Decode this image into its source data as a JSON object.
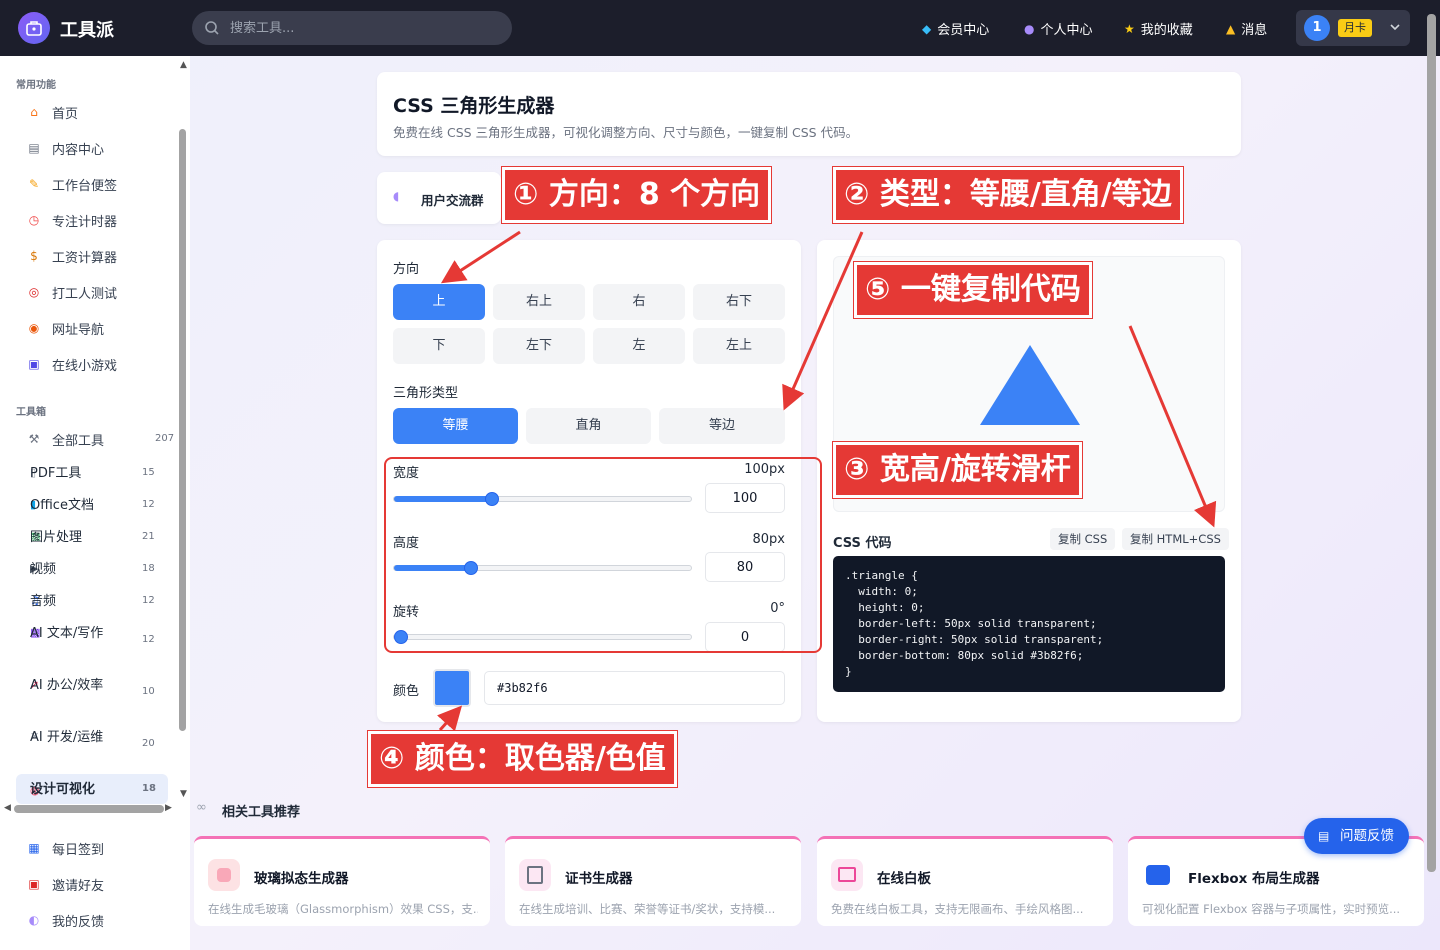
{
  "header": {
    "brand": "工具派",
    "search_placeholder": "搜索工具...",
    "nav": [
      {
        "label": "会员中心",
        "icon": "diamond-icon"
      },
      {
        "label": "个人中心",
        "icon": "user-icon"
      },
      {
        "label": "我的收藏",
        "icon": "star-icon"
      },
      {
        "label": "消息",
        "icon": "bell-icon"
      }
    ],
    "user": {
      "avatar": "1",
      "badge": "月卡"
    }
  },
  "sidebar": {
    "common_title": "常用功能",
    "common_items": [
      {
        "label": "首页",
        "icon": "home-icon"
      },
      {
        "label": "内容中心",
        "icon": "news-icon"
      },
      {
        "label": "工作台便签",
        "icon": "memo-icon"
      },
      {
        "label": "专注计时器",
        "icon": "timer-icon"
      },
      {
        "label": "工资计算器",
        "icon": "money-bag-icon"
      },
      {
        "label": "打工人测试",
        "icon": "target-icon"
      },
      {
        "label": "网址导航",
        "icon": "compass-icon"
      },
      {
        "label": "在线小游戏",
        "icon": "gamepad-icon"
      }
    ],
    "toolbox_title": "工具箱",
    "all_tools": {
      "label": "全部工具",
      "count": "207"
    },
    "sub_items": [
      {
        "label": "PDF工具",
        "count": "15",
        "icon": "pdf-icon"
      },
      {
        "label": "Office文档",
        "count": "12",
        "icon": "doc-icon"
      },
      {
        "label": "图片处理",
        "count": "21",
        "icon": "image-icon"
      },
      {
        "label": "视频",
        "count": "18",
        "icon": "video-icon"
      },
      {
        "label": "音频",
        "count": "12",
        "icon": "music-icon"
      },
      {
        "label": "AI 文本/写作",
        "count": "12",
        "icon": "robot-icon"
      },
      {
        "label": "AI 办公/效率",
        "count": "10",
        "icon": "rocket-icon"
      },
      {
        "label": "AI 开发/运维",
        "count": "20",
        "icon": "wrench-icon"
      },
      {
        "label": "设计可视化",
        "count": "18",
        "icon": "palette-icon"
      }
    ],
    "bottom_items": [
      {
        "label": "每日签到",
        "icon": "calendar-icon"
      },
      {
        "label": "邀请好友",
        "icon": "gift-icon"
      },
      {
        "label": "我的反馈",
        "icon": "speech-bubble-icon"
      }
    ]
  },
  "page": {
    "title": "CSS 三角形生成器",
    "description": "免费在线 CSS 三角形生成器，可视化调整方向、尺寸与颜色，一键复制 CSS 代码。",
    "group_chat": "用户交流群"
  },
  "controls": {
    "direction_label": "方向",
    "directions": [
      "上",
      "右上",
      "右",
      "右下",
      "下",
      "左下",
      "左",
      "左上"
    ],
    "selected_direction": "上",
    "type_label": "三角形类型",
    "types": [
      "等腰",
      "直角",
      "等边"
    ],
    "selected_type": "等腰",
    "width": {
      "label": "宽度",
      "display": "100px",
      "value": "100",
      "fraction": 0.33
    },
    "height": {
      "label": "高度",
      "display": "80px",
      "value": "80",
      "fraction": 0.26
    },
    "rotate": {
      "label": "旋转",
      "display": "0°",
      "value": "0",
      "fraction": 0.0
    },
    "color_label": "颜色",
    "color_value": "#3b82f6"
  },
  "output": {
    "code_label": "CSS 代码",
    "copy_css": "复制 CSS",
    "copy_html_css": "复制 HTML+CSS",
    "code_lines": [
      ".triangle {",
      "  width: 0;",
      "  height: 0;",
      "  border-left: 50px solid transparent;",
      "  border-right: 50px solid transparent;",
      "  border-bottom: 80px solid #3b82f6;",
      "}"
    ]
  },
  "annotations": {
    "a1": "① 方向：8 个方向",
    "a2": "② 类型：等腰/直角/等边",
    "a3": "③ 宽高/旋转滑杆",
    "a4": "④ 颜色：取色器/色值",
    "a5": "⑤ 一键复制代码"
  },
  "related": {
    "title": "相关工具推荐",
    "items": [
      {
        "name": "玻璃拟态生成器",
        "desc": "在线生成毛玻璃（Glassmorphism）效果 CSS，支...",
        "icon": "glass-icon"
      },
      {
        "name": "证书生成器",
        "desc": "在线生成培训、比赛、荣誉等证书/奖状，支持模...",
        "icon": "certificate-icon"
      },
      {
        "name": "在线白板",
        "desc": "免费在线白板工具，支持无限画布、手绘风格图...",
        "icon": "whiteboard-icon"
      },
      {
        "name": "Flexbox 布局生成器",
        "desc": "可视化配置 Flexbox 容器与子项属性，实时预览...",
        "icon": "flexbox-icon"
      }
    ]
  },
  "feedback_button": "问题反馈",
  "colors": {
    "accent": "#3b82f6",
    "annotation": "#e53935",
    "topbar": "#1c1e2b"
  }
}
